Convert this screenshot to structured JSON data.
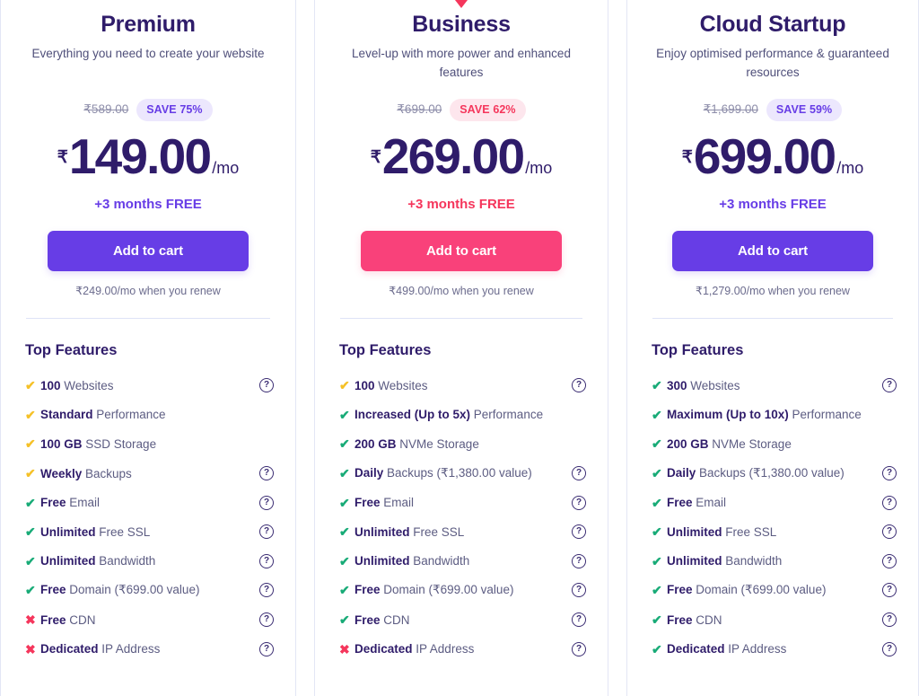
{
  "colors": {
    "brand_violet": "#673de6",
    "brand_pink": "#f5365c",
    "cta_pink": "#f9417a",
    "heading_navy": "#2f1c6a",
    "check_green": "#18ab77",
    "check_yellow": "#f5c127",
    "divider": "#dfe3f7"
  },
  "common": {
    "features_title": "Top Features",
    "cta_label": "Add to cart",
    "period_suffix": "/mo",
    "currency_symbol": "₹",
    "help_icon_glyph": "?"
  },
  "plans": [
    {
      "id": "premium",
      "name": "Premium",
      "description": "Everything you need to create your website",
      "old_price": "₹589.00",
      "save_badge": "SAVE 75%",
      "save_badge_style": "violet",
      "currency": "₹",
      "price": "149.00",
      "period": "/mo",
      "months_free": "+3 months FREE",
      "months_free_style": "violet",
      "cta_label": "Add to cart",
      "cta_style": "violet",
      "renew_note": "₹249.00/mo when you renew",
      "popular_tail": false,
      "features_title": "Top Features",
      "features": [
        {
          "mark": "check",
          "mark_color": "yellow",
          "lead": "100",
          "rest": " Websites",
          "help": true
        },
        {
          "mark": "check",
          "mark_color": "yellow",
          "lead": "Standard",
          "rest": " Performance",
          "help": false
        },
        {
          "mark": "check",
          "mark_color": "yellow",
          "lead": "100 GB",
          "rest": " SSD Storage",
          "help": false
        },
        {
          "mark": "check",
          "mark_color": "yellow",
          "lead": "Weekly",
          "rest": " Backups",
          "help": true
        },
        {
          "mark": "check",
          "mark_color": "green",
          "lead": "Free",
          "rest": " Email",
          "help": true
        },
        {
          "mark": "check",
          "mark_color": "green",
          "lead": "Unlimited",
          "rest": " Free SSL",
          "help": true
        },
        {
          "mark": "check",
          "mark_color": "green",
          "lead": "Unlimited",
          "rest": " Bandwidth",
          "help": true
        },
        {
          "mark": "check",
          "mark_color": "green",
          "lead": "Free",
          "rest": " Domain (₹699.00 value)",
          "help": true
        },
        {
          "mark": "cross",
          "mark_color": "pink",
          "lead": "Free",
          "rest": " CDN",
          "help": true
        },
        {
          "mark": "cross",
          "mark_color": "pink",
          "lead": "Dedicated",
          "rest": " IP Address",
          "help": true
        }
      ]
    },
    {
      "id": "business",
      "name": "Business",
      "description": "Level-up with more power and enhanced features",
      "old_price": "₹699.00",
      "save_badge": "SAVE 62%",
      "save_badge_style": "pink",
      "currency": "₹",
      "price": "269.00",
      "period": "/mo",
      "months_free": "+3 months FREE",
      "months_free_style": "pink",
      "cta_label": "Add to cart",
      "cta_style": "pink",
      "renew_note": "₹499.00/mo when you renew",
      "popular_tail": true,
      "features_title": "Top Features",
      "features": [
        {
          "mark": "check",
          "mark_color": "yellow",
          "lead": "100",
          "rest": " Websites",
          "help": true
        },
        {
          "mark": "check",
          "mark_color": "green",
          "lead": "Increased (Up to 5x)",
          "rest": " Performance",
          "help": false
        },
        {
          "mark": "check",
          "mark_color": "green",
          "lead": "200 GB",
          "rest": " NVMe Storage",
          "help": false
        },
        {
          "mark": "check",
          "mark_color": "green",
          "lead": "Daily",
          "rest": " Backups (₹1,380.00 value)",
          "help": true
        },
        {
          "mark": "check",
          "mark_color": "green",
          "lead": "Free",
          "rest": " Email",
          "help": true
        },
        {
          "mark": "check",
          "mark_color": "green",
          "lead": "Unlimited",
          "rest": " Free SSL",
          "help": true
        },
        {
          "mark": "check",
          "mark_color": "green",
          "lead": "Unlimited",
          "rest": " Bandwidth",
          "help": true
        },
        {
          "mark": "check",
          "mark_color": "green",
          "lead": "Free",
          "rest": " Domain (₹699.00 value)",
          "help": true
        },
        {
          "mark": "check",
          "mark_color": "green",
          "lead": "Free",
          "rest": " CDN",
          "help": true
        },
        {
          "mark": "cross",
          "mark_color": "pink",
          "lead": "Dedicated",
          "rest": " IP Address",
          "help": true
        }
      ]
    },
    {
      "id": "cloud-startup",
      "name": "Cloud Startup",
      "description": "Enjoy optimised performance & guaranteed resources",
      "old_price": "₹1,699.00",
      "save_badge": "SAVE 59%",
      "save_badge_style": "violet",
      "currency": "₹",
      "price": "699.00",
      "period": "/mo",
      "months_free": "+3 months FREE",
      "months_free_style": "violet",
      "cta_label": "Add to cart",
      "cta_style": "violet",
      "renew_note": "₹1,279.00/mo when you renew",
      "popular_tail": false,
      "features_title": "Top Features",
      "features": [
        {
          "mark": "check",
          "mark_color": "green",
          "lead": "300",
          "rest": " Websites",
          "help": true
        },
        {
          "mark": "check",
          "mark_color": "green",
          "lead": "Maximum (Up to 10x)",
          "rest": " Performance",
          "help": false
        },
        {
          "mark": "check",
          "mark_color": "green",
          "lead": "200 GB",
          "rest": " NVMe Storage",
          "help": false
        },
        {
          "mark": "check",
          "mark_color": "green",
          "lead": "Daily",
          "rest": " Backups (₹1,380.00 value)",
          "help": true
        },
        {
          "mark": "check",
          "mark_color": "green",
          "lead": "Free",
          "rest": " Email",
          "help": true
        },
        {
          "mark": "check",
          "mark_color": "green",
          "lead": "Unlimited",
          "rest": " Free SSL",
          "help": true
        },
        {
          "mark": "check",
          "mark_color": "green",
          "lead": "Unlimited",
          "rest": " Bandwidth",
          "help": true
        },
        {
          "mark": "check",
          "mark_color": "green",
          "lead": "Free",
          "rest": " Domain (₹699.00 value)",
          "help": true
        },
        {
          "mark": "check",
          "mark_color": "green",
          "lead": "Free",
          "rest": " CDN",
          "help": true
        },
        {
          "mark": "check",
          "mark_color": "green",
          "lead": "Dedicated",
          "rest": " IP Address",
          "help": true
        }
      ]
    }
  ]
}
